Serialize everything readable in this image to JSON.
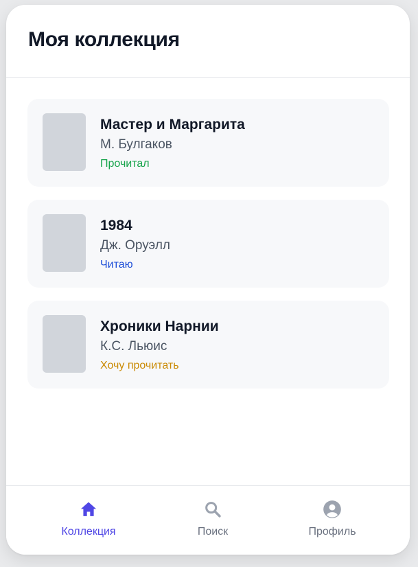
{
  "header": {
    "title": "Моя коллекция"
  },
  "books": [
    {
      "title": "Мастер и Маргарита",
      "author": "М. Булгаков",
      "status": "Прочитал",
      "status_color": "#16a34a"
    },
    {
      "title": "1984",
      "author": "Дж. Оруэлл",
      "status": "Читаю",
      "status_color": "#1d4ed8"
    },
    {
      "title": "Хроники Нарнии",
      "author": "К.С. Льюис",
      "status": "Хочу прочитать",
      "status_color": "#ca8a04"
    }
  ],
  "nav": {
    "items": [
      {
        "label": "Коллекция",
        "icon": "home-icon",
        "active": true
      },
      {
        "label": "Поиск",
        "icon": "search-icon",
        "active": false
      },
      {
        "label": "Профиль",
        "icon": "user-circle-icon",
        "active": false
      }
    ],
    "active_color": "#4f46e5",
    "inactive_color": "#6b7280",
    "inactive_icon_color": "#9ca3af"
  }
}
